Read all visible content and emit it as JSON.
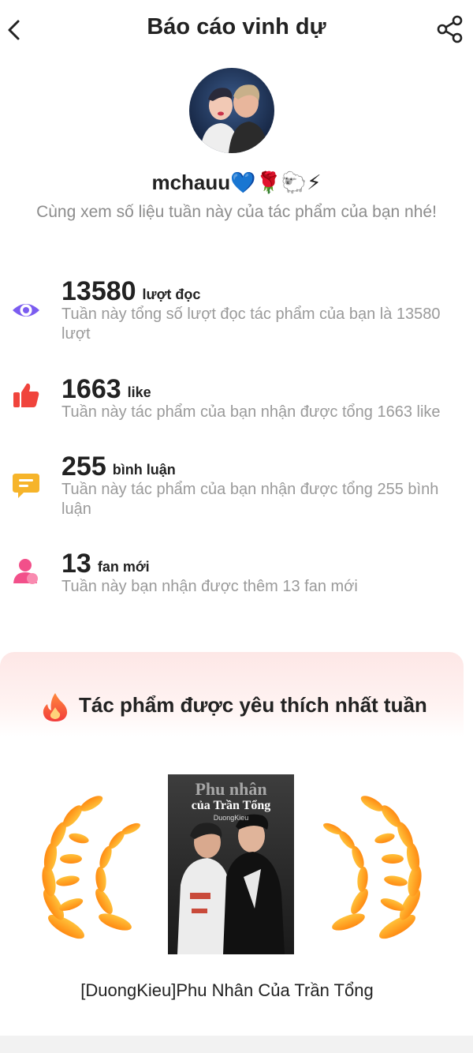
{
  "header": {
    "title": "Báo cáo vinh dự",
    "back_icon": "chevron-left-icon",
    "share_icon": "share-icon"
  },
  "profile": {
    "username": "mchauu💙🌹🐑⚡",
    "subtitle": "Cùng xem số liệu tuần này của tác phẩm của bạn nhé!"
  },
  "stats": [
    {
      "icon": "eye-icon",
      "value": "13580",
      "unit": "lượt đọc",
      "description": "Tuần này tổng số lượt đọc tác phẩm của bạn là 13580 lượt",
      "color": "#7b5cf0"
    },
    {
      "icon": "thumbs-up-icon",
      "value": "1663",
      "unit": "like",
      "description": "Tuần này tác phẩm của bạn nhận được tổng 1663 like",
      "color": "#f0443c"
    },
    {
      "icon": "comment-icon",
      "value": "255",
      "unit": "bình luận",
      "description": "Tuần này tác phẩm của bạn nhận được tổng 255 bình luận",
      "color": "#f6b42a"
    },
    {
      "icon": "user-icon",
      "value": "13",
      "unit": "fan mới",
      "description": "Tuần này bạn nhận được thêm 13 fan mới",
      "color": "#f2508a"
    }
  ],
  "favorite": {
    "title": "Tác phẩm được yêu thích nhất tuần",
    "cover_title_line1": "Phu nhân",
    "cover_title_line2": "của Trần Tổng",
    "cover_author": "DuongKieu",
    "work_name": "[DuongKieu]Phu Nhân Của Trần Tổng"
  }
}
